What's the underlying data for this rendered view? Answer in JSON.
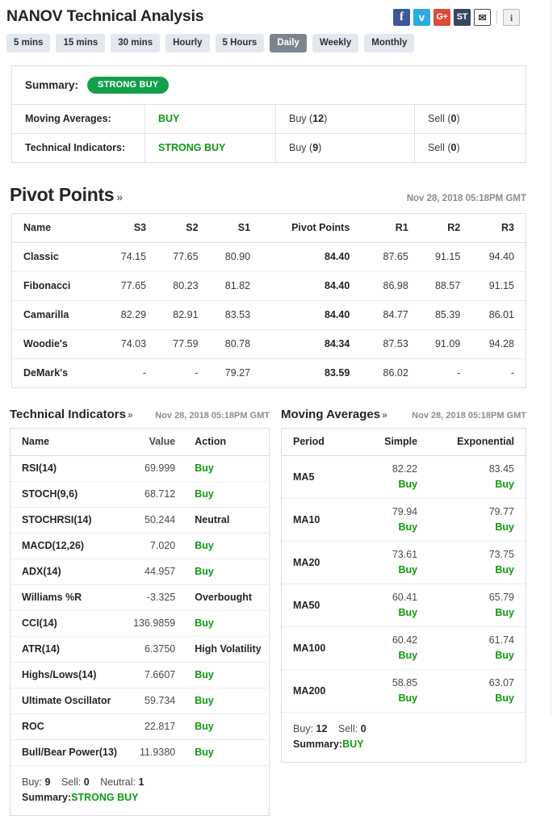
{
  "header": {
    "title": "NANOV Technical Analysis",
    "social": [
      {
        "name": "facebook-share-icon",
        "glyph": "f",
        "class": "soc-fb"
      },
      {
        "name": "twitter-share-icon",
        "glyph": "ᴠ",
        "class": "soc-tw"
      },
      {
        "name": "google-plus-share-icon",
        "glyph": "G+",
        "class": "soc-gp"
      },
      {
        "name": "stocktwits-share-icon",
        "glyph": "ST",
        "class": "soc-st"
      },
      {
        "name": "email-share-icon",
        "glyph": "✉",
        "class": "soc-mail"
      },
      {
        "name": "info-icon",
        "glyph": "i",
        "class": "soc-info"
      }
    ]
  },
  "timeframe_tabs": [
    {
      "label": "5 mins",
      "active": false
    },
    {
      "label": "15 mins",
      "active": false
    },
    {
      "label": "30 mins",
      "active": false
    },
    {
      "label": "Hourly",
      "active": false
    },
    {
      "label": "5 Hours",
      "active": false
    },
    {
      "label": "Daily",
      "active": true
    },
    {
      "label": "Weekly",
      "active": false
    },
    {
      "label": "Monthly",
      "active": false
    }
  ],
  "summary": {
    "label": "Summary:",
    "badge": "STRONG BUY",
    "rows": [
      {
        "name": "Moving Averages:",
        "signal": "BUY",
        "buy": "Buy (12)",
        "sell": "Sell (0)"
      },
      {
        "name": "Technical Indicators:",
        "signal": "STRONG BUY",
        "buy": "Buy (9)",
        "sell": "Sell (0)"
      }
    ]
  },
  "pivot_points": {
    "title": "Pivot Points",
    "chevron": "»",
    "date": "Nov 28, 2018 05:18PM GMT",
    "columns": [
      "Name",
      "S3",
      "S2",
      "S1",
      "Pivot Points",
      "R1",
      "R2",
      "R3"
    ],
    "rows": [
      {
        "name": "Classic",
        "s3": "74.15",
        "s2": "77.65",
        "s1": "80.90",
        "pp": "84.40",
        "r1": "87.65",
        "r2": "91.15",
        "r3": "94.40"
      },
      {
        "name": "Fibonacci",
        "s3": "77.65",
        "s2": "80.23",
        "s1": "81.82",
        "pp": "84.40",
        "r1": "86.98",
        "r2": "88.57",
        "r3": "91.15"
      },
      {
        "name": "Camarilla",
        "s3": "82.29",
        "s2": "82.91",
        "s1": "83.53",
        "pp": "84.40",
        "r1": "84.77",
        "r2": "85.39",
        "r3": "86.01"
      },
      {
        "name": "Woodie's",
        "s3": "74.03",
        "s2": "77.59",
        "s1": "80.78",
        "pp": "84.34",
        "r1": "87.53",
        "r2": "91.09",
        "r3": "94.28"
      },
      {
        "name": "DeMark's",
        "s3": "-",
        "s2": "-",
        "s1": "79.27",
        "pp": "83.59",
        "r1": "86.02",
        "r2": "-",
        "r3": "-"
      }
    ]
  },
  "technical_indicators": {
    "title": "Technical Indicators",
    "chevron": "»",
    "date": "Nov 28, 2018 05:18PM GMT",
    "columns": [
      "Name",
      "Value",
      "Action"
    ],
    "rows": [
      {
        "name": "RSI(14)",
        "value": "69.999",
        "action": "Buy",
        "action_type": "buy"
      },
      {
        "name": "STOCH(9,6)",
        "value": "68.712",
        "action": "Buy",
        "action_type": "buy"
      },
      {
        "name": "STOCHRSI(14)",
        "value": "50.244",
        "action": "Neutral",
        "action_type": "neutral"
      },
      {
        "name": "MACD(12,26)",
        "value": "7.020",
        "action": "Buy",
        "action_type": "buy"
      },
      {
        "name": "ADX(14)",
        "value": "44.957",
        "action": "Buy",
        "action_type": "buy"
      },
      {
        "name": "Williams %R",
        "value": "-3.325",
        "action": "Overbought",
        "action_type": "other"
      },
      {
        "name": "CCI(14)",
        "value": "136.9859",
        "action": "Buy",
        "action_type": "buy"
      },
      {
        "name": "ATR(14)",
        "value": "6.3750",
        "action": "High Volatility",
        "action_type": "other"
      },
      {
        "name": "Highs/Lows(14)",
        "value": "7.6607",
        "action": "Buy",
        "action_type": "buy"
      },
      {
        "name": "Ultimate Oscillator",
        "value": "59.734",
        "action": "Buy",
        "action_type": "buy"
      },
      {
        "name": "ROC",
        "value": "22.817",
        "action": "Buy",
        "action_type": "buy"
      },
      {
        "name": "Bull/Bear Power(13)",
        "value": "11.9380",
        "action": "Buy",
        "action_type": "buy"
      }
    ],
    "footer": {
      "buy_label": "Buy:",
      "buy_count": "9",
      "sell_label": "Sell:",
      "sell_count": "0",
      "neutral_label": "Neutral:",
      "neutral_count": "1",
      "summary_label": "Summary:",
      "summary_value": "STRONG BUY"
    }
  },
  "moving_averages": {
    "title": "Moving Averages",
    "chevron": "»",
    "date": "Nov 28, 2018 05:18PM GMT",
    "columns": [
      "Period",
      "Simple",
      "Exponential"
    ],
    "rows": [
      {
        "period": "MA5",
        "simple": "82.22",
        "simple_action": "Buy",
        "exp": "83.45",
        "exp_action": "Buy"
      },
      {
        "period": "MA10",
        "simple": "79.94",
        "simple_action": "Buy",
        "exp": "79.77",
        "exp_action": "Buy"
      },
      {
        "period": "MA20",
        "simple": "73.61",
        "simple_action": "Buy",
        "exp": "73.75",
        "exp_action": "Buy"
      },
      {
        "period": "MA50",
        "simple": "60.41",
        "simple_action": "Buy",
        "exp": "65.79",
        "exp_action": "Buy"
      },
      {
        "period": "MA100",
        "simple": "60.42",
        "simple_action": "Buy",
        "exp": "61.74",
        "exp_action": "Buy"
      },
      {
        "period": "MA200",
        "simple": "58.85",
        "simple_action": "Buy",
        "exp": "63.07",
        "exp_action": "Buy"
      }
    ],
    "footer": {
      "buy_label": "Buy:",
      "buy_count": "12",
      "sell_label": "Sell:",
      "sell_count": "0",
      "summary_label": "Summary:",
      "summary_value": "BUY"
    }
  },
  "colors": {
    "buy_green": "#0f9a10",
    "badge_green": "#13a04b",
    "active_tab": "#7c848f",
    "tab_bg": "#e3e8ef"
  }
}
